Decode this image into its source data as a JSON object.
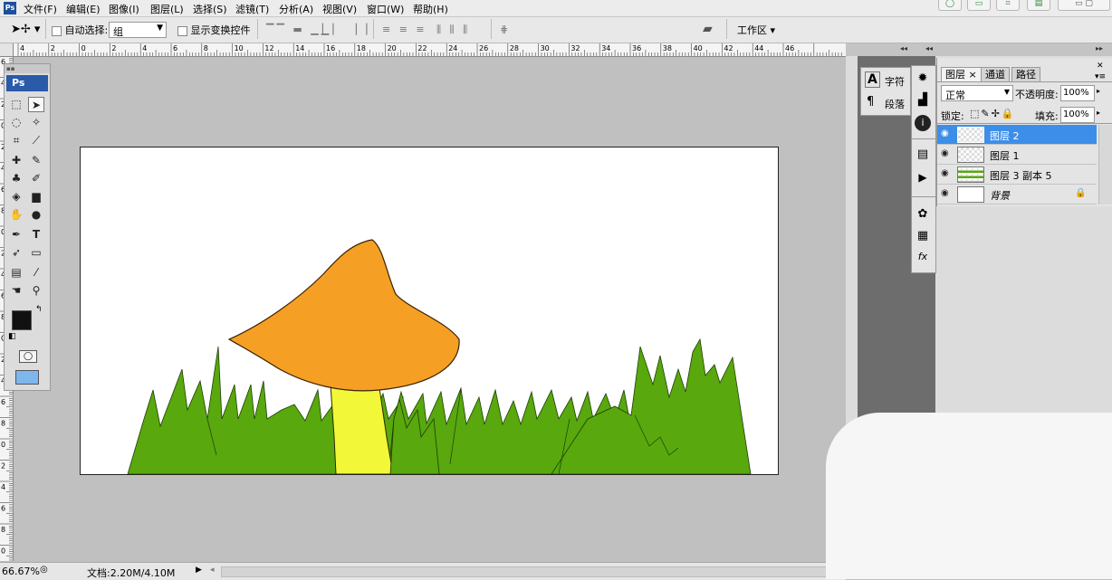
{
  "menubar": {
    "app_icon": "Ps",
    "items": [
      "文件(F)",
      "编辑(E)",
      "图像(I)",
      "图层(L)",
      "选择(S)",
      "滤镜(T)",
      "分析(A)",
      "视图(V)",
      "窗口(W)",
      "帮助(H)"
    ]
  },
  "options": {
    "auto_select_label": "自动选择:",
    "auto_select_value": "组",
    "show_transform_label": "显示变换控件",
    "workspace_label": "工作区 ▾"
  },
  "rulers": {
    "h_ticks": [
      "4",
      "2",
      "0",
      "2",
      "4",
      "6",
      "8",
      "10",
      "12",
      "14",
      "16",
      "18",
      "20",
      "22",
      "24",
      "26",
      "28",
      "30",
      "32",
      "34",
      "36",
      "38",
      "40",
      "42",
      "44",
      "46"
    ],
    "v_ticks": [
      "6",
      "4",
      "2",
      "0",
      "2",
      "4",
      "6",
      "8",
      "0",
      "2",
      "4",
      "6",
      "8",
      "0",
      "2",
      "4",
      "6",
      "8",
      "0",
      "2",
      "4",
      "6",
      "8",
      "0"
    ]
  },
  "toolbox": {
    "title": "Ps"
  },
  "status": {
    "zoom": "66.67%",
    "doc": "文档:2.20M/4.10M"
  },
  "char_panel": {
    "char_label": "字符",
    "para_label": "段落"
  },
  "layers_panel": {
    "tabs": [
      "图层 ×",
      "通道",
      "路径"
    ],
    "blend_mode": "正常",
    "opacity_label": "不透明度:",
    "opacity_value": "100%",
    "lock_label": "锁定:",
    "fill_label": "填充:",
    "fill_value": "100%",
    "layers": [
      {
        "name": "图层 2",
        "selected": true
      },
      {
        "name": "图层 1",
        "selected": false
      },
      {
        "name": "图层 3 副本 5",
        "selected": false
      },
      {
        "name": "背景",
        "selected": false,
        "locked": true
      }
    ]
  },
  "colors": {
    "grass": "#58a80e",
    "mushroom_cap": "#f5a024",
    "mushroom_stem": "#f2f838",
    "selection_blue": "#3d8ee8",
    "canvas_bg": "#c0c0c0"
  },
  "icons": [
    "move-tool-icon",
    "marquee-icon",
    "lasso-icon",
    "magic-wand-icon",
    "crop-icon",
    "slice-icon",
    "heal-icon",
    "brush-icon",
    "stamp-icon",
    "history-brush-icon",
    "eraser-icon",
    "gradient-icon",
    "blur-icon",
    "dodge-icon",
    "pen-icon",
    "type-icon",
    "path-select-icon",
    "shape-icon",
    "notes-icon",
    "eyedropper-icon",
    "hand-icon",
    "zoom-icon",
    "eye-icon",
    "lock-icon"
  ]
}
